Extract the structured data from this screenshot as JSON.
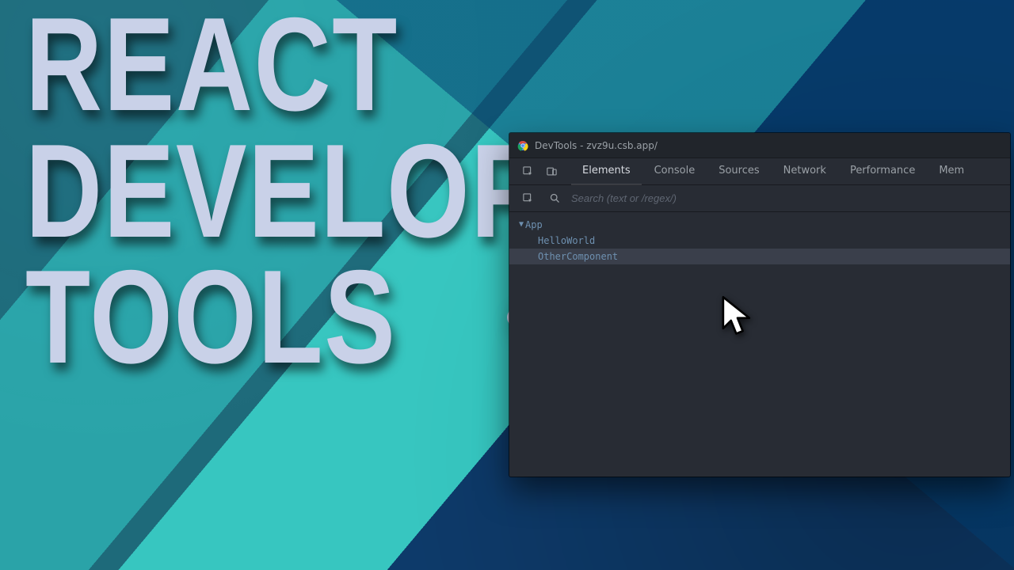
{
  "headline": {
    "line1": "REACT",
    "line2": "DEVELOPER",
    "line3": "TOOLS"
  },
  "devtools": {
    "window_title": "DevTools - zvz9u.csb.app/",
    "tabs": {
      "t0": "Elements",
      "t1": "Console",
      "t2": "Sources",
      "t3": "Network",
      "t4": "Performance",
      "t5": "Mem"
    },
    "search_placeholder": "Search (text or /regex/)",
    "tree": {
      "root": "App",
      "child1": "HelloWorld",
      "child2": "OtherComponent"
    }
  }
}
